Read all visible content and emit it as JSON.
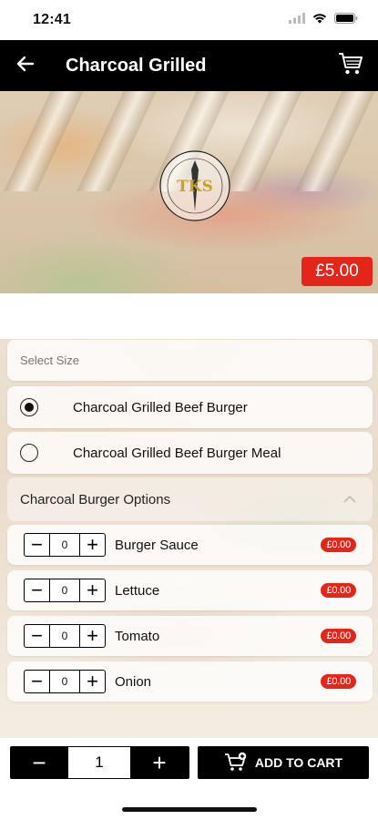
{
  "status_bar": {
    "time": "12:41"
  },
  "app_bar": {
    "title": "Charcoal Grilled",
    "back_icon": "arrow-left-icon",
    "cart_icon": "cart-icon"
  },
  "hero": {
    "logo_text": "TKS",
    "price": "£5.00"
  },
  "size_section": {
    "placeholder": "Select Size",
    "options": [
      {
        "label": "Charcoal Grilled Beef Burger",
        "selected": true
      },
      {
        "label": "Charcoal Grilled Beef Burger Meal",
        "selected": false
      }
    ]
  },
  "options_section": {
    "title": "Charcoal Burger Options",
    "items": [
      {
        "name": "Burger Sauce",
        "qty": "0",
        "price": "£0.00"
      },
      {
        "name": "Lettuce",
        "qty": "0",
        "price": "£0.00"
      },
      {
        "name": "Tomato",
        "qty": "0",
        "price": "£0.00"
      },
      {
        "name": "Onion",
        "qty": "0",
        "price": "£0.00"
      }
    ]
  },
  "footer": {
    "quantity": "1",
    "add_to_cart_label": "ADD TO CART"
  },
  "colors": {
    "accent_red": "#e32619",
    "bar_black": "#000000"
  }
}
